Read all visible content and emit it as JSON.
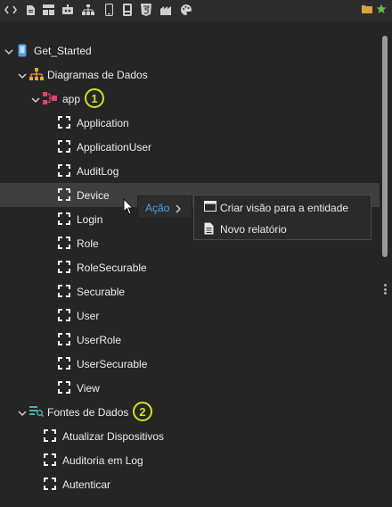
{
  "toolbar": {
    "icons": [
      "code-icon",
      "document-icon",
      "layout-icon",
      "robot-icon",
      "sitemap-icon",
      "mobile-icon",
      "device-icon",
      "html5-icon",
      "workflow-icon",
      "palette-icon"
    ],
    "right_icons": [
      "folder-icon",
      "star-icon"
    ],
    "colors": {
      "folder": "#d9a43a",
      "star": "#5fbf4a"
    }
  },
  "tree": {
    "project": {
      "label": "Get_Started"
    },
    "diagrams": {
      "label": "Diagramas de Dados",
      "app": {
        "label": "app",
        "badge": "1",
        "entities": [
          "Application",
          "ApplicationUser",
          "AuditLog",
          "Device",
          "Login",
          "Role",
          "RoleSecurable",
          "Securable",
          "User",
          "UserRole",
          "UserSecurable",
          "View"
        ]
      }
    },
    "datasources": {
      "label": "Fontes de Dados",
      "badge": "2",
      "items": [
        "Atualizar Dispositivos",
        "Auditoria em Log",
        "Autenticar"
      ]
    },
    "selected_entity": "Device"
  },
  "context_menu": {
    "label": "Ação",
    "submenu": [
      {
        "label": "Criar visão para a entidade",
        "icon": "window-icon"
      },
      {
        "label": "Novo relatório",
        "icon": "report-icon"
      }
    ]
  },
  "colors": {
    "badge": "#d4e11a",
    "context_link": "#4aa3e6",
    "diagram_icon": "#e8a23a",
    "app_icon": "#e0436a",
    "datasource_icon": "#3fb6a8",
    "project_icon": "#4a9fe0"
  }
}
